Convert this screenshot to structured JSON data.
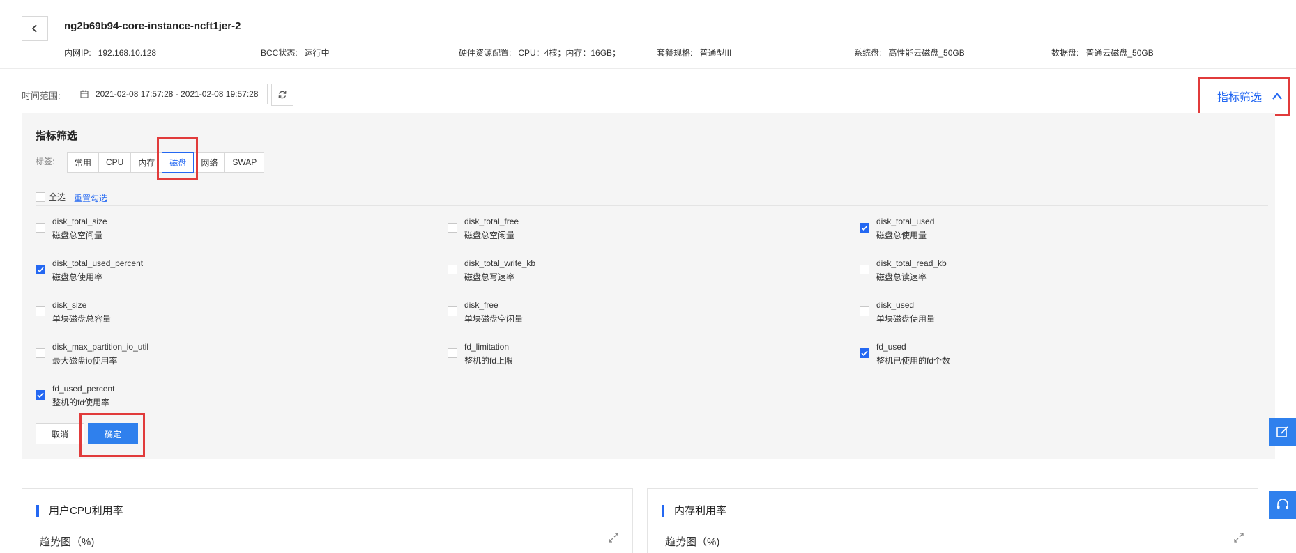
{
  "header": {
    "title": "ng2b69b94-core-instance-ncft1jer-2",
    "info": [
      {
        "key": "内网IP:",
        "value": "192.168.10.128"
      },
      {
        "key": "BCC状态:",
        "value": "运行中"
      },
      {
        "key": "硬件资源配置:",
        "value": "CPU：4核；内存：16GB；"
      },
      {
        "key": "套餐规格:",
        "value": "普通型III"
      },
      {
        "key": "系统盘:",
        "value": "高性能云磁盘_50GB"
      },
      {
        "key": "数据盘:",
        "value": "普通云磁盘_50GB"
      }
    ]
  },
  "time_range": {
    "label": "时间范围:",
    "value": "2021-02-08 17:57:28 - 2021-02-08 19:57:28"
  },
  "filter_toggle": {
    "label": "指标筛选"
  },
  "panel": {
    "title": "指标筛选",
    "tag_label": "标签:",
    "tabs": [
      {
        "label": "常用",
        "active": false
      },
      {
        "label": "CPU",
        "active": false
      },
      {
        "label": "内存",
        "active": false
      },
      {
        "label": "磁盘",
        "active": true
      },
      {
        "label": "网络",
        "active": false
      },
      {
        "label": "SWAP",
        "active": false
      }
    ],
    "select_all": "全选",
    "reset": "重置勾选",
    "metrics": [
      {
        "name": "disk_total_size",
        "desc": "磁盘总空间量",
        "checked": false
      },
      {
        "name": "disk_total_free",
        "desc": "磁盘总空闲量",
        "checked": false
      },
      {
        "name": "disk_total_used",
        "desc": "磁盘总使用量",
        "checked": true
      },
      {
        "name": "disk_total_used_percent",
        "desc": "磁盘总使用率",
        "checked": true
      },
      {
        "name": "disk_total_write_kb",
        "desc": "磁盘总写速率",
        "checked": false
      },
      {
        "name": "disk_total_read_kb",
        "desc": "磁盘总读速率",
        "checked": false
      },
      {
        "name": "disk_size",
        "desc": "单块磁盘总容量",
        "checked": false
      },
      {
        "name": "disk_free",
        "desc": "单块磁盘空闲量",
        "checked": false
      },
      {
        "name": "disk_used",
        "desc": "单块磁盘使用量",
        "checked": false
      },
      {
        "name": "disk_max_partition_io_util",
        "desc": "最大磁盘io使用率",
        "checked": false
      },
      {
        "name": "fd_limitation",
        "desc": "整机的fd上限",
        "checked": false
      },
      {
        "name": "fd_used",
        "desc": "整机已使用的fd个数",
        "checked": true
      },
      {
        "name": "fd_used_percent",
        "desc": "整机的fd使用率",
        "checked": true
      }
    ],
    "cancel_label": "取消",
    "ok_label": "确定"
  },
  "cards": [
    {
      "title": "用户CPU利用率",
      "subtitle": "趋势图（%)"
    },
    {
      "title": "内存利用率",
      "subtitle": "趋势图（%)"
    }
  ],
  "colors": {
    "accent": "#2468f2",
    "highlight": "#e13b3b",
    "panel_bg": "#f5f5f5"
  }
}
